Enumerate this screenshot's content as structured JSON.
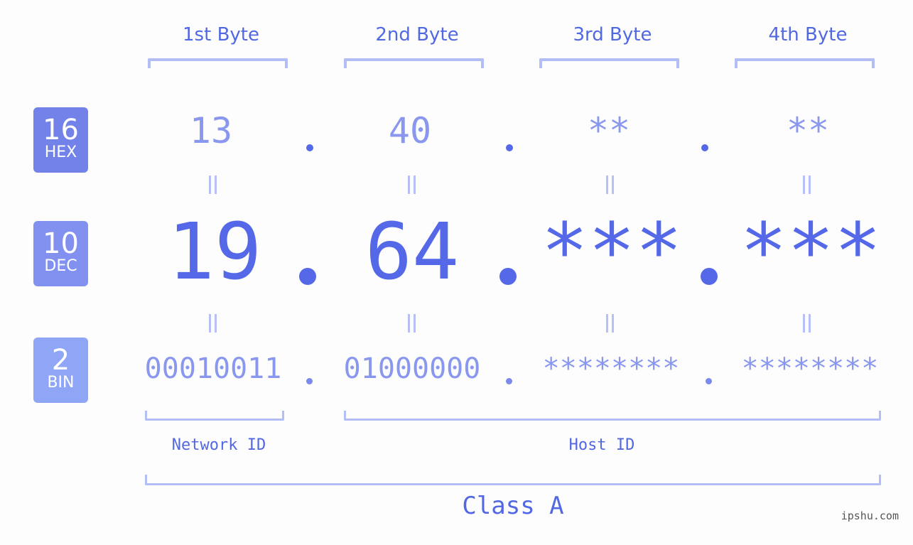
{
  "byte_headers": [
    "1st Byte",
    "2nd Byte",
    "3rd Byte",
    "4th Byte"
  ],
  "badges": [
    {
      "num": "16",
      "label": "HEX",
      "color": "#7282e9"
    },
    {
      "num": "10",
      "label": "DEC",
      "color": "#8291ef"
    },
    {
      "num": "2",
      "label": "BIN",
      "color": "#8fa5f6"
    }
  ],
  "hex": [
    "13",
    "40",
    "**",
    "**"
  ],
  "dec": [
    "19",
    "64",
    "***",
    "***"
  ],
  "bin": [
    "00010011",
    "01000000",
    "********",
    "********"
  ],
  "network_label": "Network ID",
  "host_label": "Host ID",
  "class_label": "Class A",
  "watermark": "ipshu.com"
}
